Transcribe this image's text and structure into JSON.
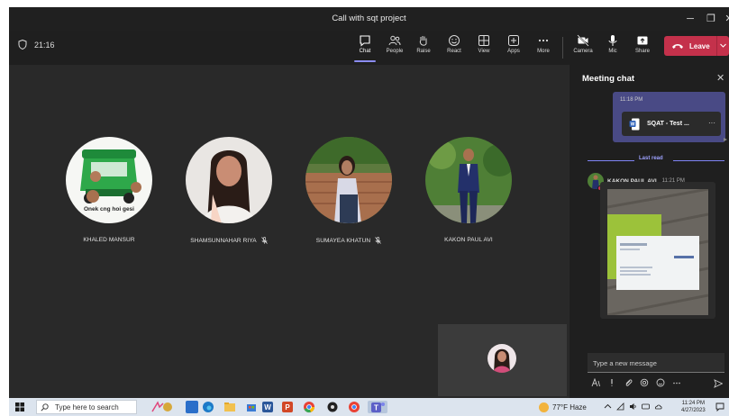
{
  "window": {
    "title": "Call with sqt project",
    "controls": {
      "minimize": "─",
      "maximize": "❐",
      "close": "✕"
    }
  },
  "toolbar": {
    "timer": "21:16",
    "buttons": [
      {
        "label": "Chat",
        "icon": "chat-icon",
        "active": true
      },
      {
        "label": "People",
        "icon": "people-icon"
      },
      {
        "label": "Raise",
        "icon": "raise-hand-icon"
      },
      {
        "label": "React",
        "icon": "react-icon"
      },
      {
        "label": "View",
        "icon": "view-icon"
      },
      {
        "label": "Apps",
        "icon": "apps-icon"
      },
      {
        "label": "More",
        "icon": "more-icon"
      },
      {
        "label": "Camera",
        "icon": "camera-off-icon"
      },
      {
        "label": "Mic",
        "icon": "mic-icon"
      },
      {
        "label": "Share",
        "icon": "share-icon"
      }
    ],
    "leave_label": "Leave",
    "leave_color": "#c4314b"
  },
  "participants": [
    {
      "name": "KHALED MANSUR",
      "muted": false,
      "avatar_caption": "Onek cng hoi gesi"
    },
    {
      "name": "SHAMSUNNAHAR RIYA",
      "muted": true
    },
    {
      "name": "SUMAYEA KHATUN",
      "muted": true
    },
    {
      "name": "KAKON PAUL AVI",
      "muted": false
    }
  ],
  "chat": {
    "header": "Meeting chat",
    "my_message": {
      "time": "11:18 PM",
      "file_name": "SQAT - Test ..."
    },
    "last_read_label": "Last read",
    "incoming": {
      "sender": "KAKON PAUL AVI",
      "time": "11:21 PM"
    },
    "compose_placeholder": "Type a new message",
    "accent": "#7f85f5"
  },
  "taskbar": {
    "search_placeholder": "Type here to search",
    "weather": "77°F  Haze",
    "time": "11:24 PM",
    "date": "4/27/2023"
  }
}
